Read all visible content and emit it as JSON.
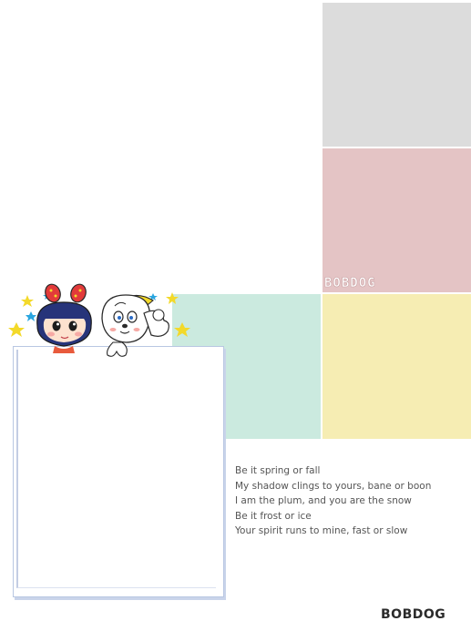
{
  "logo_pixel_text": "BOBDOG",
  "poem": {
    "lines": [
      "Be it spring or fall",
      "My shadow clings to yours, bane or boon",
      "I am the plum, and you are the snow",
      "Be it frost or ice",
      "Your spirit runs to mine, fast or slow"
    ]
  },
  "brand": "BOBDOG",
  "colors": {
    "gray": "#dcdcdc",
    "pink": "#e4c4c5",
    "mint": "#cbeadf",
    "yellow": "#f6edb3",
    "frame_border": "#b9c7e2"
  },
  "icons": [
    "star-icon",
    "girl-mascot-icon",
    "bobdog-mascot-icon"
  ]
}
